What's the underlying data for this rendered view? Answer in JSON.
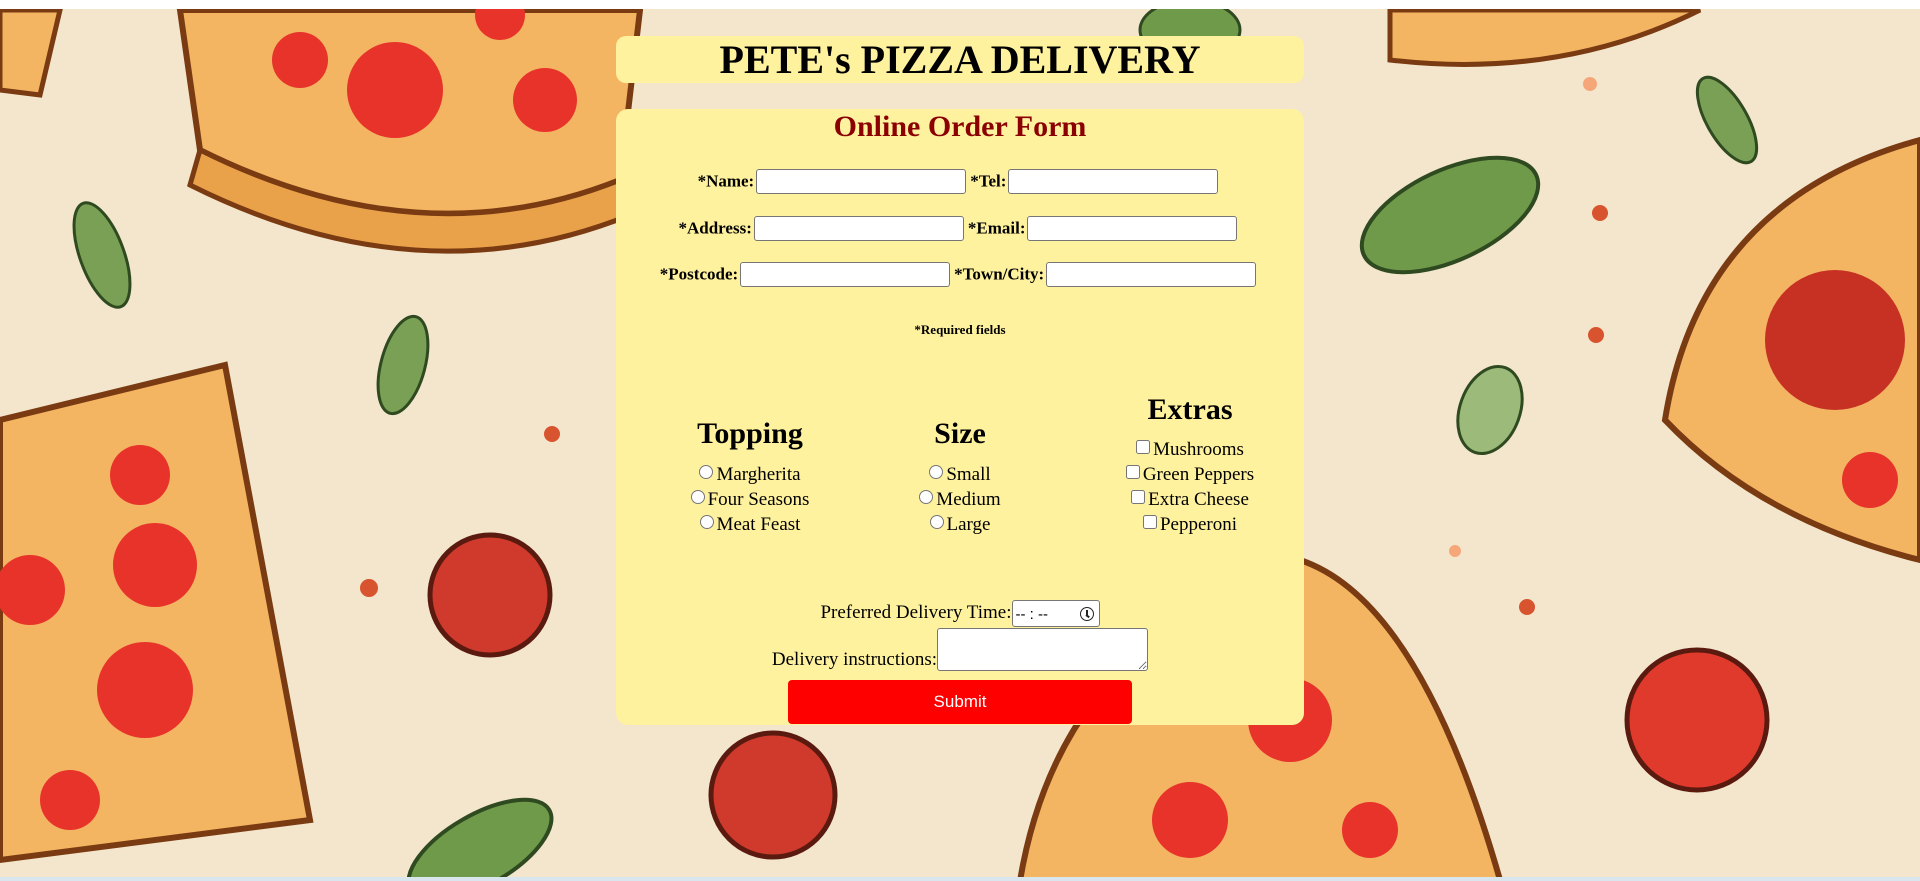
{
  "header": {
    "title": "PETE's PIZZA DELIVERY"
  },
  "form": {
    "title": "Online Order Form",
    "fields": {
      "name": {
        "label": "*Name:",
        "value": ""
      },
      "tel": {
        "label": "*Tel:",
        "value": ""
      },
      "address": {
        "label": "*Address:",
        "value": ""
      },
      "email": {
        "label": "*Email:",
        "value": ""
      },
      "postcode": {
        "label": "*Postcode:",
        "value": ""
      },
      "town": {
        "label": "*Town/City:",
        "value": ""
      }
    },
    "required_note": "*Required fields",
    "topping": {
      "heading": "Topping",
      "options": [
        "Margherita",
        "Four Seasons",
        "Meat Feast"
      ]
    },
    "size": {
      "heading": "Size",
      "options": [
        "Small",
        "Medium",
        "Large"
      ]
    },
    "extras": {
      "heading": "Extras",
      "options": [
        "Mushrooms",
        "Green Peppers",
        "Extra Cheese",
        "Pepperoni"
      ]
    },
    "delivery_time": {
      "label": "Preferred Delivery Time:",
      "value": "-- : --"
    },
    "instructions": {
      "label": "Delivery instructions:",
      "value": ""
    },
    "submit_label": "Submit"
  },
  "colors": {
    "panel": "#fff29f",
    "form_title": "#8b0000",
    "submit": "#ff0000",
    "background": "#f3e6cc"
  }
}
